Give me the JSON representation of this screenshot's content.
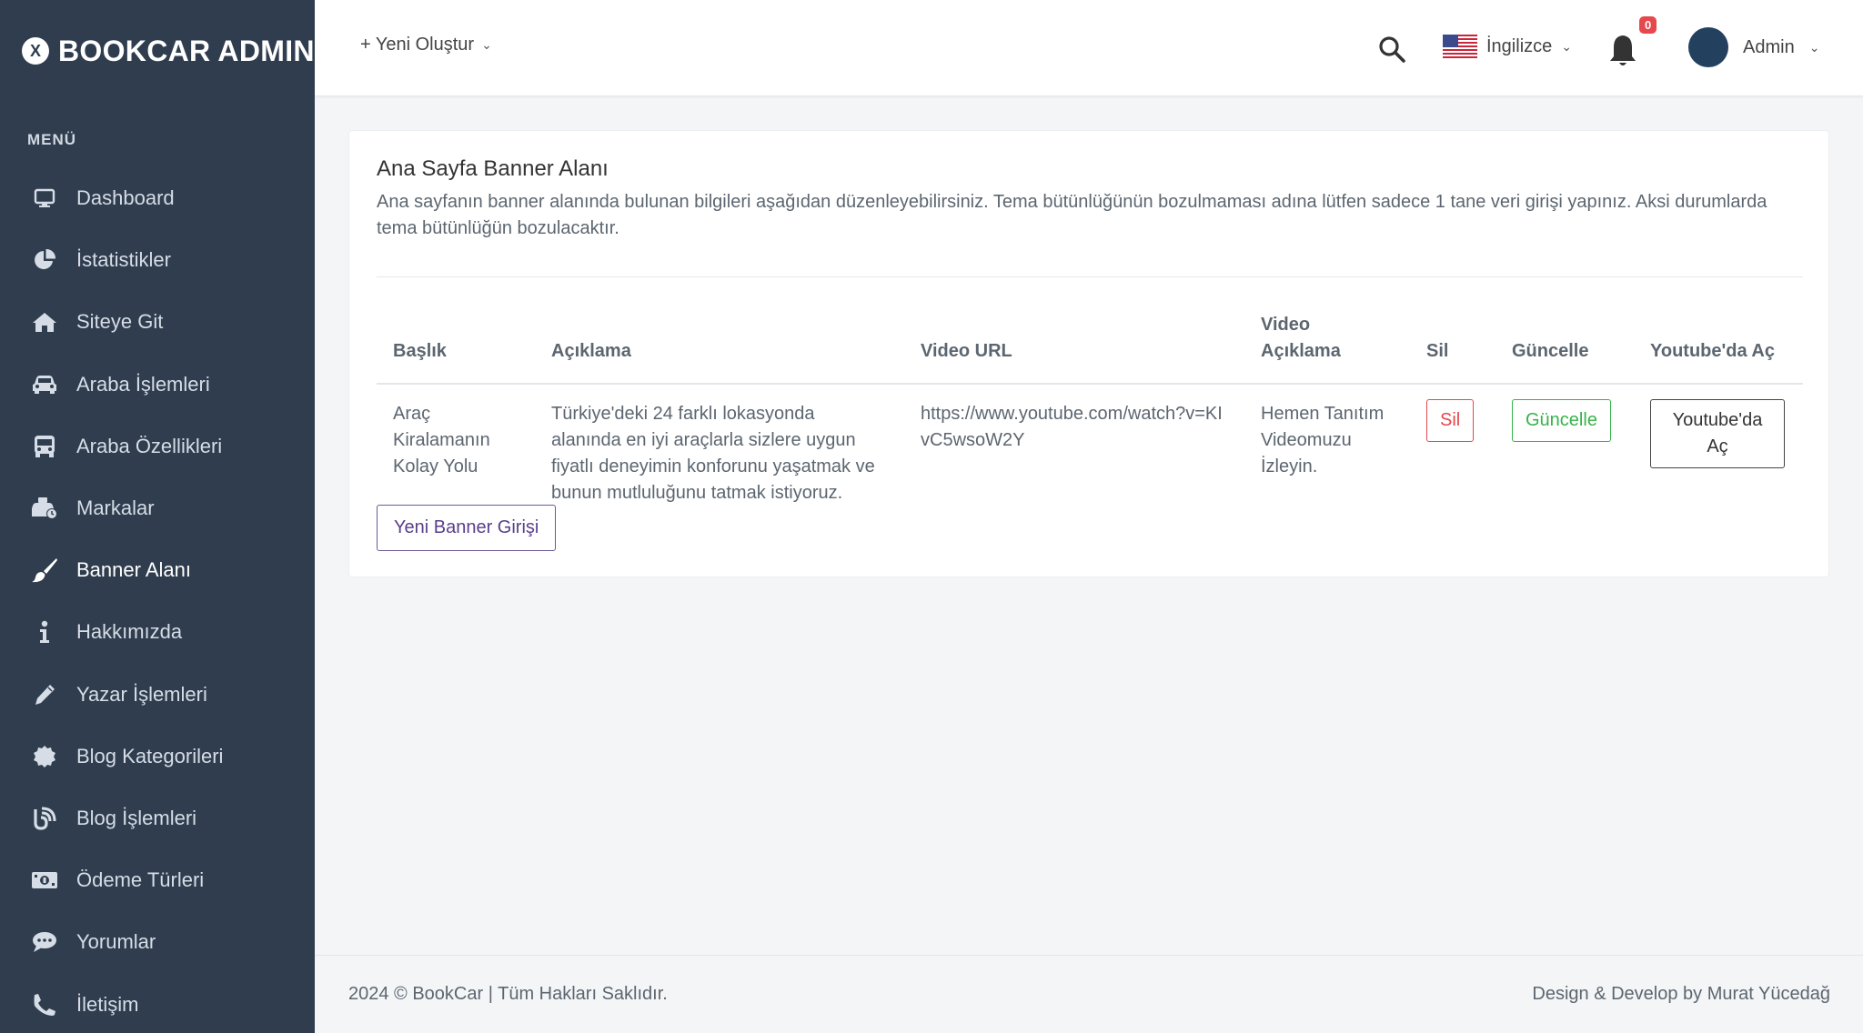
{
  "sidebar": {
    "brand": "BOOKCAR ADMIN",
    "brand_logo": "X",
    "menu_label": "MENÜ",
    "items": [
      {
        "label": "Dashboard",
        "icon": "monitor-icon"
      },
      {
        "label": "İstatistikler",
        "icon": "pie-chart-icon"
      },
      {
        "label": "Siteye Git",
        "icon": "home-icon"
      },
      {
        "label": "Araba İşlemleri",
        "icon": "car-icon"
      },
      {
        "label": "Araba Özellikleri",
        "icon": "bus-icon"
      },
      {
        "label": "Markalar",
        "icon": "car-shop-icon"
      },
      {
        "label": "Banner Alanı",
        "icon": "brush-icon",
        "active": true
      },
      {
        "label": "Hakkımızda",
        "icon": "info-icon"
      },
      {
        "label": "Yazar İşlemleri",
        "icon": "pencil-icon"
      },
      {
        "label": "Blog Kategorileri",
        "icon": "certificate-icon"
      },
      {
        "label": "Blog İşlemleri",
        "icon": "blog-icon"
      },
      {
        "label": "Ödeme Türleri",
        "icon": "money-icon"
      },
      {
        "label": "Yorumlar",
        "icon": "comment-icon"
      },
      {
        "label": "İletişim",
        "icon": "phone-icon"
      }
    ]
  },
  "topbar": {
    "create_label": "+ Yeni Oluştur",
    "language": "İngilizce",
    "notification_count": "0",
    "user_name": "Admin"
  },
  "card": {
    "title": "Ana Sayfa Banner Alanı",
    "description": "Ana sayfanın banner alanında bulunan bilgileri aşağıdan düzenleyebilirsiniz. Tema bütünlüğünün bozulmaması adına lütfen sadece 1 tane veri girişi yapınız. Aksi durumlarda tema bütünlüğün bozulacaktır.",
    "columns": [
      "Başlık",
      "Açıklama",
      "Video URL",
      "Video Açıklama",
      "Sil",
      "Güncelle",
      "Youtube'da Aç"
    ],
    "rows": [
      {
        "title": "Araç Kiralamanın Kolay Yolu",
        "description": "Türkiye'deki 24 farklı lokasyonda alanında en iyi araçlarla sizlere uygun fiyatlı deneyimin konforunu yaşatmak ve bunun mutluluğunu tatmak istiyoruz.",
        "video_url": "https://www.youtube.com/watch?v=KIvC5wsoW2Y",
        "video_description": "Hemen Tanıtım Videomuzu İzleyin.",
        "delete_label": "Sil",
        "update_label": "Güncelle",
        "youtube_label": "Youtube'da Aç"
      }
    ],
    "new_button": "Yeni Banner Girişi"
  },
  "footer": {
    "left": "2024 © BookCar | Tüm Hakları Saklıdır.",
    "right": "Design & Develop by Murat Yücedağ"
  },
  "colors": {
    "sidebar_bg": "#2f3d4e",
    "danger": "#e5484d",
    "success": "#35b34a",
    "primary_outline": "#5a3f8c"
  }
}
